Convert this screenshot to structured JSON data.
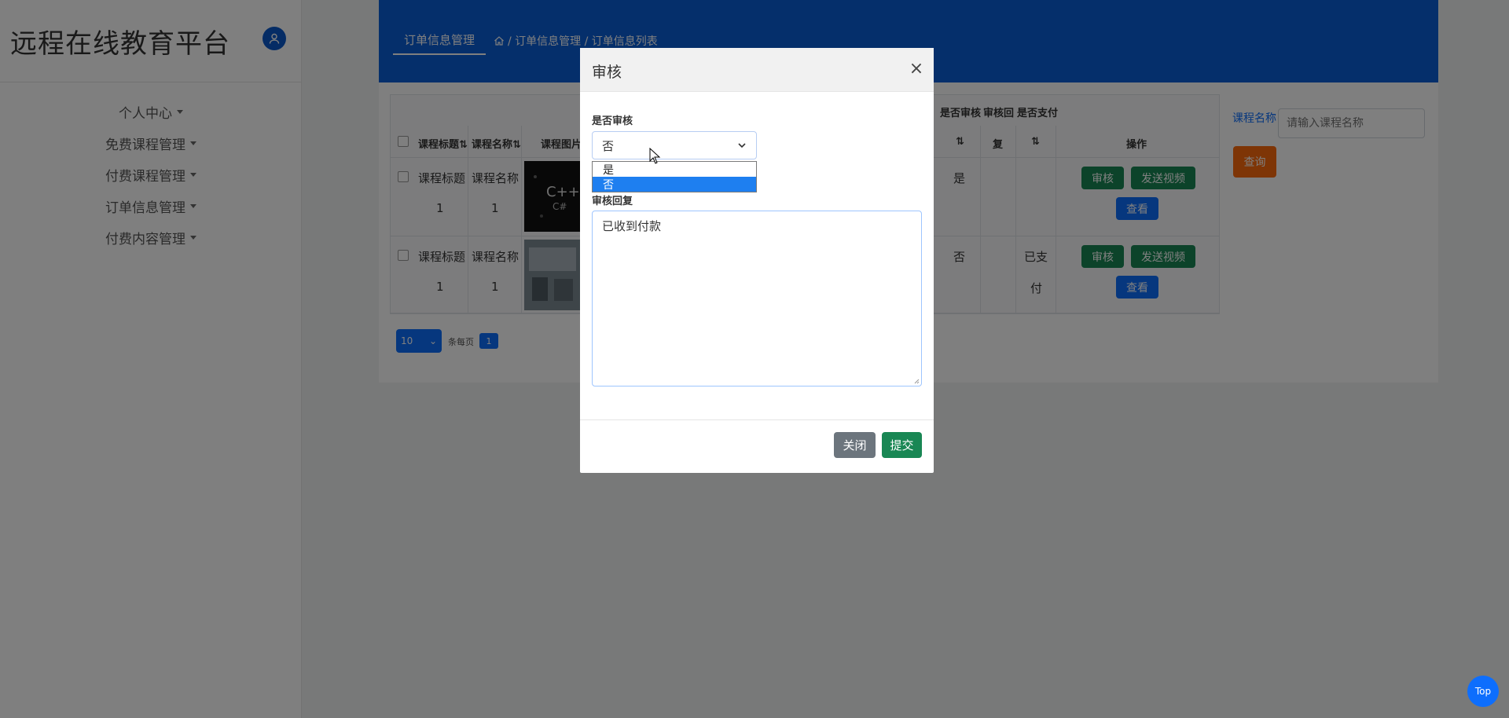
{
  "app": {
    "title": "远程在线教育平台"
  },
  "sidebar": {
    "items": [
      {
        "label": "个人中心"
      },
      {
        "label": "免费课程管理"
      },
      {
        "label": "付费课程管理"
      },
      {
        "label": "订单信息管理"
      },
      {
        "label": "付费内容管理"
      }
    ]
  },
  "header": {
    "tab": "订单信息管理",
    "breadcrumb": "/ 订单信息管理 / 订单信息列表"
  },
  "table": {
    "columns": {
      "title": "课程标题",
      "name": "课程名称",
      "image": "课程图片",
      "audited": "是否审核",
      "reply": "审核回",
      "reply2": "复",
      "paid": "是否支付",
      "actions": "操作"
    },
    "rows": [
      {
        "title": "课程标题",
        "title_num": "1",
        "name": "课程名称",
        "name_num": "1",
        "audited": "是",
        "paid_a": "",
        "paid_b": ""
      },
      {
        "title": "课程标题",
        "title_num": "1",
        "name": "课程名称",
        "name_num": "1",
        "audited": "否",
        "paid_a": "已支",
        "paid_b": "付"
      }
    ],
    "actions": {
      "audit": "审核",
      "send_video": "发送视频",
      "view": "查看"
    }
  },
  "search": {
    "label": "课程名称",
    "placeholder": "请输入课程名称",
    "button": "查询"
  },
  "pager": {
    "page_size": "10",
    "per_page_text": "条每页",
    "current_page": "1"
  },
  "modal": {
    "title": "审核",
    "close_symbol": "×",
    "field_audit_label": "是否审核",
    "select_value": "否",
    "options": [
      "是",
      "否"
    ],
    "field_reply_label": "审核回复",
    "reply_value": "已收到付款",
    "close_button": "关闭",
    "submit_button": "提交"
  },
  "top_button": "Top"
}
